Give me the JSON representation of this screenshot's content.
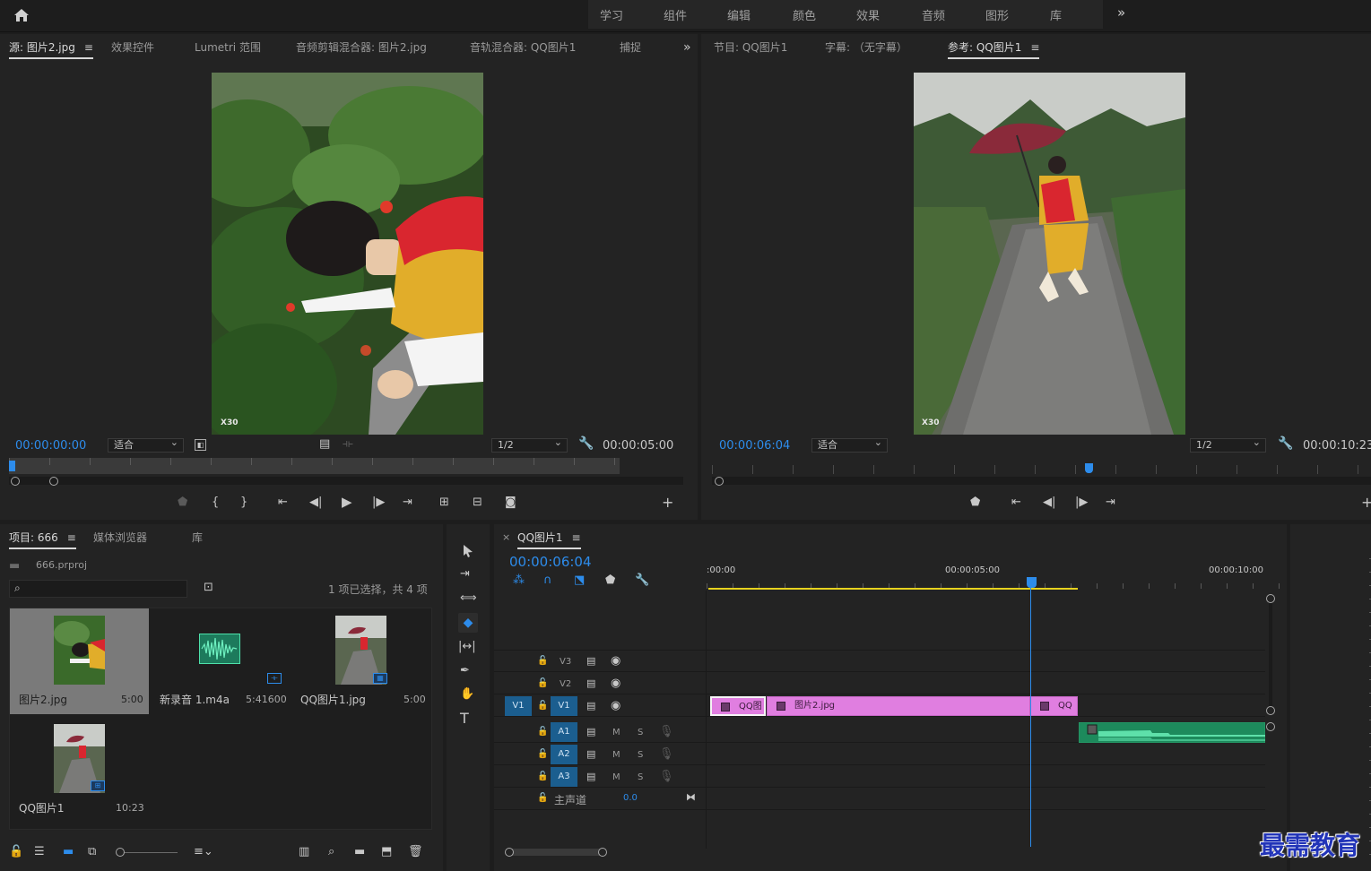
{
  "header": {
    "menu": [
      "学习",
      "组件",
      "编辑",
      "颜色",
      "效果",
      "音频",
      "图形",
      "库"
    ],
    "more_glyph": "»"
  },
  "source": {
    "tabs": [
      "源: 图片2.jpg",
      "效果控件",
      "Lumetri 范围",
      "音频剪辑混合器: 图片2.jpg",
      "音轨混合器: QQ图片1",
      "捕捉"
    ],
    "timecode": "00:00:00:00",
    "fit": "适合",
    "res": "1/2",
    "duration": "00:00:05:00",
    "watermark": "X30"
  },
  "program": {
    "tabs": [
      "节目: QQ图片1",
      "字幕: （无字幕）",
      "参考: QQ图片1"
    ],
    "timecode": "00:00:06:04",
    "fit": "适合",
    "res": "1/2",
    "duration": "00:00:10:23",
    "watermark": "X30"
  },
  "project": {
    "tabs": [
      "项目: 666",
      "媒体浏览器",
      "库"
    ],
    "file": "666.prproj",
    "search_placeholder": "",
    "selection": "1 项已选择，共 4 项",
    "items": [
      {
        "name": "图片2.jpg",
        "dur": "5:00"
      },
      {
        "name": "新录音 1.m4a",
        "dur": "5:41600"
      },
      {
        "name": "QQ图片1.jpg",
        "dur": "5:00"
      },
      {
        "name": "QQ图片1",
        "dur": "10:23"
      }
    ]
  },
  "timeline": {
    "tab": "QQ图片1",
    "close": "×",
    "timecode": "00:00:06:04",
    "ruler": [
      ":00:00",
      "00:00:05:00",
      "00:00:10:00"
    ],
    "video_tracks": [
      "V3",
      "V2",
      "V1"
    ],
    "source_target": "V1",
    "audio_tracks": [
      "A1",
      "A2",
      "A3"
    ],
    "mute": "M",
    "solo": "S",
    "master": "主声道",
    "master_vol": "0.0",
    "clips": [
      "QQ图",
      "图片2.jpg",
      "QQ"
    ]
  },
  "brand": "最需教育",
  "colors": {
    "accent": "#2d8ceb",
    "video_clip": "#e07ee0",
    "audio_clip": "#1d8a5c",
    "workarea": "#e6d21e"
  }
}
